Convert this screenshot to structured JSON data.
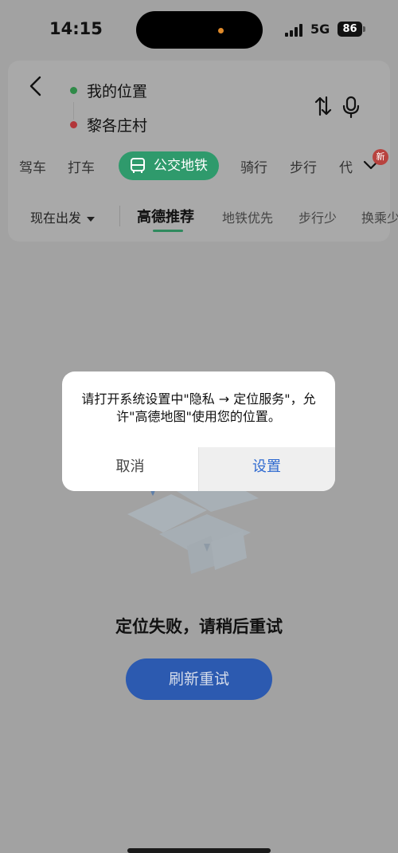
{
  "status_bar": {
    "time": "14:15",
    "network": "5G",
    "battery": "86"
  },
  "route": {
    "from": "我的位置",
    "to": "黎各庄村"
  },
  "modes": {
    "items": [
      "驾车",
      "打车",
      "公交地铁",
      "骑行",
      "步行",
      "代"
    ],
    "active": "公交地铁",
    "badge": "新"
  },
  "prefs": {
    "depart": "现在出发",
    "items": [
      "高德推荐",
      "地铁优先",
      "步行少",
      "换乘少"
    ],
    "active": "高德推荐"
  },
  "result": {
    "message": "定位失败，请稍后重试",
    "retry_label": "刷新重试"
  },
  "dialog": {
    "message": "请打开系统设置中\"隐私 → 定位服务\"，允许\"高德地图\"使用您的位置。",
    "cancel_label": "取消",
    "settings_label": "设置"
  },
  "colors": {
    "accent_green": "#2f9a6c",
    "link_blue": "#2f6ad0",
    "retry_blue": "#2c5ab0"
  }
}
